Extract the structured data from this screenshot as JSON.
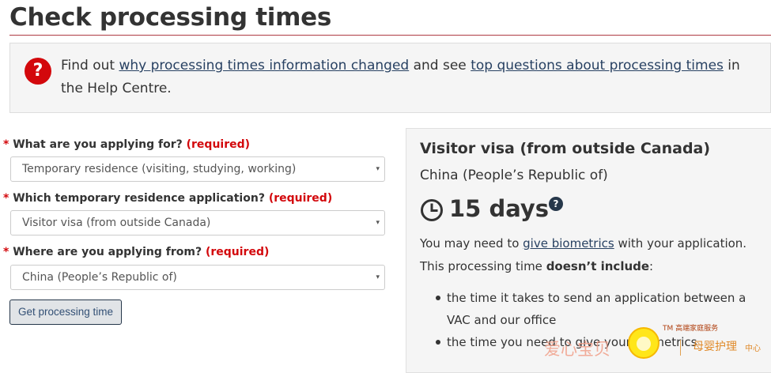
{
  "page": {
    "title": "Check processing times"
  },
  "alert": {
    "icon": "question-mark-icon",
    "icon_glyph": "?",
    "text_before": "Find out ",
    "link1": "why processing times information changed",
    "text_middle": " and see ",
    "link2": "top questions about processing times",
    "text_after": " in the Help Centre."
  },
  "form": {
    "required_marker": "*",
    "required_text": "(required)",
    "fields": [
      {
        "label": "What are you applying for?",
        "value": "Temporary residence (visiting, studying, working)"
      },
      {
        "label": "Which temporary residence application?",
        "value": "Visitor visa (from outside Canada)"
      },
      {
        "label": "Where are you applying from?",
        "value": "China (People’s Republic of)"
      }
    ],
    "caret": "▾",
    "submit_label": "Get processing time"
  },
  "result": {
    "title": "Visitor visa (from outside Canada)",
    "country": "China (People’s Republic of)",
    "days": "15 days",
    "help_glyph": "?",
    "biometrics_before": "You may need to ",
    "biometrics_link": "give biometrics",
    "biometrics_after": " with your application.",
    "excludes_before": "This processing time ",
    "excludes_bold": "doesn’t include",
    "excludes_after": ":",
    "bullets": [
      "the time it takes to send an application between a VAC and our office",
      "the time you need to give your biometrics"
    ]
  },
  "watermark": {
    "text1": "爱心宝贝",
    "tm": "TM 高端家庭服务",
    "text2": "母婴护理",
    "text3": "中心"
  },
  "colors": {
    "accent_red": "#d3080c",
    "link": "#284162",
    "title_rule": "#af3c43",
    "panel_bg": "#f5f5f5"
  }
}
